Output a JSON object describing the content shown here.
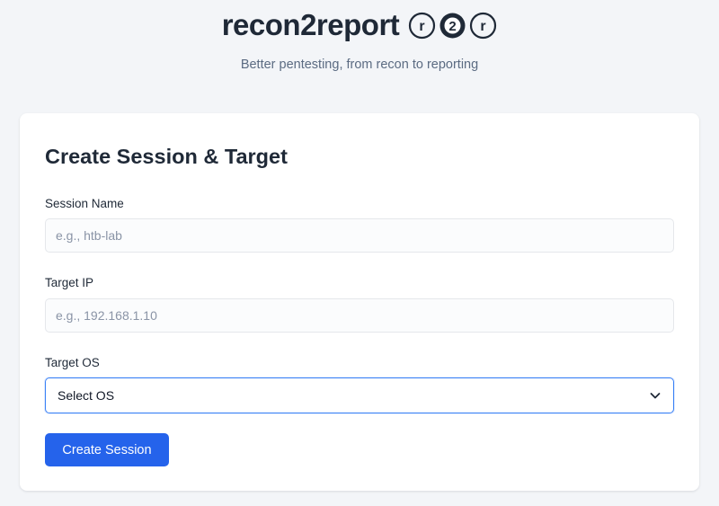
{
  "brand": {
    "title": "recon2report",
    "logo_letters": [
      "r",
      "2",
      "r"
    ],
    "tagline": "Better pentesting, from recon to reporting"
  },
  "form": {
    "title": "Create Session & Target",
    "session_name": {
      "label": "Session Name",
      "placeholder": "e.g., htb-lab",
      "value": ""
    },
    "target_ip": {
      "label": "Target IP",
      "placeholder": "e.g., 192.168.1.10",
      "value": ""
    },
    "target_os": {
      "label": "Target OS",
      "selected": "Select OS"
    },
    "submit_label": "Create Session"
  },
  "icons": {
    "select_chevron": "chevron-down-icon"
  },
  "colors": {
    "page_background": "#f3f5f8",
    "card_background": "#ffffff",
    "primary": "#2563eb",
    "focus_border": "#3b82f6",
    "text_dark": "#1f2937",
    "text_muted": "#5b6b82"
  }
}
